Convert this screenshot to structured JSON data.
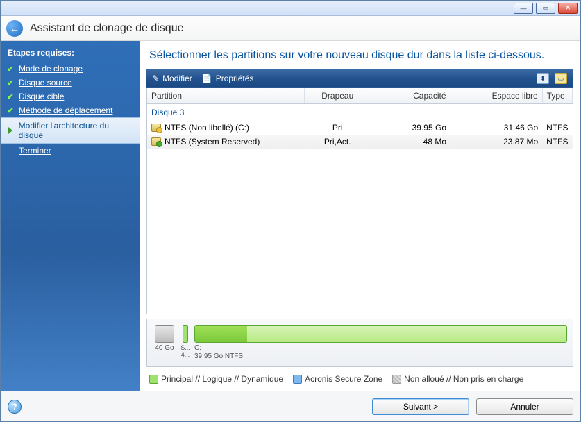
{
  "window": {
    "title": "Assistant de clonage de disque"
  },
  "sidebar": {
    "header": "Etapes requises:",
    "steps": [
      {
        "label": "Mode de clonage",
        "state": "done"
      },
      {
        "label": "Disque source",
        "state": "done"
      },
      {
        "label": "Disque cible",
        "state": "done"
      },
      {
        "label": "Méthode de déplacement",
        "state": "done"
      },
      {
        "label": "Modifier l'architecture du disque",
        "state": "current"
      },
      {
        "label": "Terminer",
        "state": "pending"
      }
    ]
  },
  "headline": "Sélectionner les partitions sur votre nouveau disque dur dans la liste ci-dessous.",
  "toolbar": {
    "edit": "Modifier",
    "props": "Propriétés"
  },
  "table": {
    "cols": {
      "partition": "Partition",
      "flag": "Drapeau",
      "capacity": "Capacité",
      "free": "Espace libre",
      "type": "Type"
    },
    "group": "Disque 3",
    "rows": [
      {
        "name": "NTFS (Non libellé) (C:)",
        "flag": "Pri",
        "capacity": "39.95 Go",
        "free": "31.46 Go",
        "type": "NTFS",
        "badge": "yellow"
      },
      {
        "name": "NTFS (System Reserved)",
        "flag": "Pri,Act.",
        "capacity": "48 Mo",
        "free": "23.87 Mo",
        "type": "NTFS",
        "badge": "green"
      }
    ]
  },
  "pmap": {
    "disk_size": "40 Go",
    "sys": {
      "label_top": "S...",
      "label_bottom": "4..."
    },
    "main": {
      "name": "C:",
      "detail": "39.95 Go  NTFS"
    }
  },
  "legend": {
    "a": "Principal // Logique // Dynamique",
    "b": "Acronis Secure Zone",
    "c": "Non alloué // Non pris en charge"
  },
  "footer": {
    "next": "Suivant >",
    "cancel": "Annuler"
  }
}
